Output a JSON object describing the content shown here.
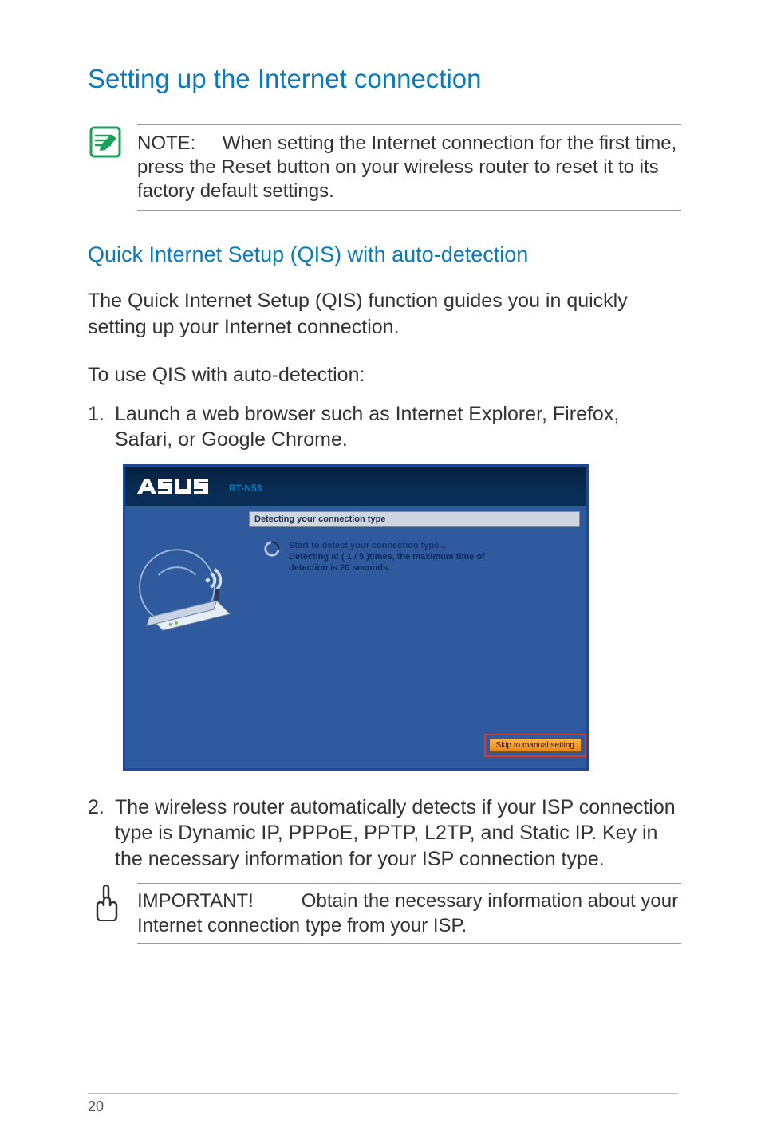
{
  "heading": "Setting up the Internet connection",
  "note": {
    "label": "NOTE:",
    "body": "When setting the Internet connection for the first time, press the Reset button on your wireless router to reset it to its factory default settings."
  },
  "subheading": "Quick Internet Setup (QIS) with auto-detection",
  "intro": "The Quick Internet Setup (QIS) function guides you in quickly setting up your Internet connection.",
  "use_line": "To use QIS with auto-detection:",
  "steps": {
    "s1_num": "1.",
    "s1_body": "Launch a web browser such as Internet Explorer, Firefox, Safari, or Google Chrome.",
    "s2_num": "2.",
    "s2_body": "The wireless router automatically detects if your ISP connection type is Dynamic IP, PPPoE, PPTP, L2TP, and Static IP. Key in the necessary information for your ISP connection type."
  },
  "screenshot": {
    "model": "RT-N53",
    "panel_title": "Detecting your connection type",
    "msg1": "Start to detect your connection type...",
    "msg2": "Detecting at ( 1 / 5 )times, the maximum time of",
    "msg3": "detection is 20 seconds.",
    "skip_label": "Skip to manual setting"
  },
  "important": {
    "label": "IMPORTANT!",
    "body": "Obtain the necessary information about your Internet connection type from your ISP."
  },
  "page_number": "20"
}
